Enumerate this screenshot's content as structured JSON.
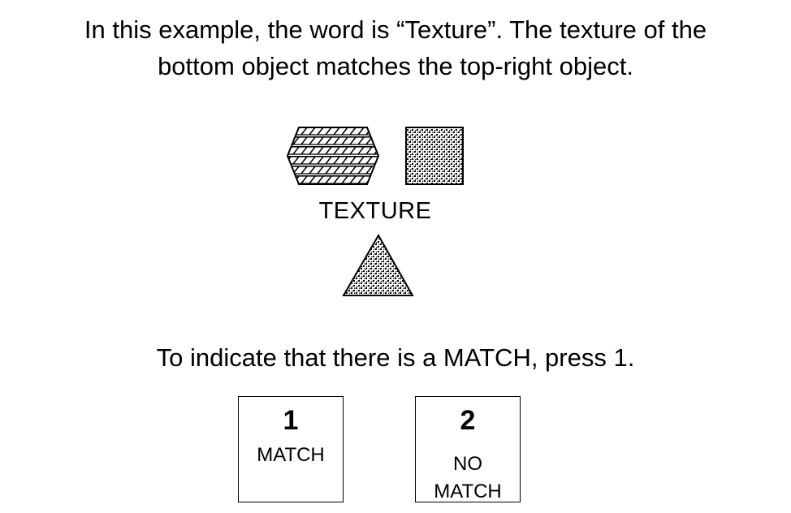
{
  "intro": {
    "line1": "In this example, the word is “Texture”. The texture of the",
    "line2": "bottom object matches the top-right object."
  },
  "stimulus": {
    "word": "TEXTURE",
    "shapes": {
      "top_left": {
        "shape": "hexagon-icon",
        "texture": "hatched-stripes"
      },
      "top_right": {
        "shape": "square-icon",
        "texture": "dots"
      },
      "bottom": {
        "shape": "triangle-icon",
        "texture": "dots"
      }
    }
  },
  "instruction": "To indicate that there is a MATCH, press 1.",
  "keys": [
    {
      "number": "1",
      "label": "MATCH"
    },
    {
      "number": "2",
      "label_line1": "NO",
      "label_line2": "MATCH"
    }
  ],
  "colors": {
    "background": "#ffffff",
    "foreground": "#000000"
  }
}
